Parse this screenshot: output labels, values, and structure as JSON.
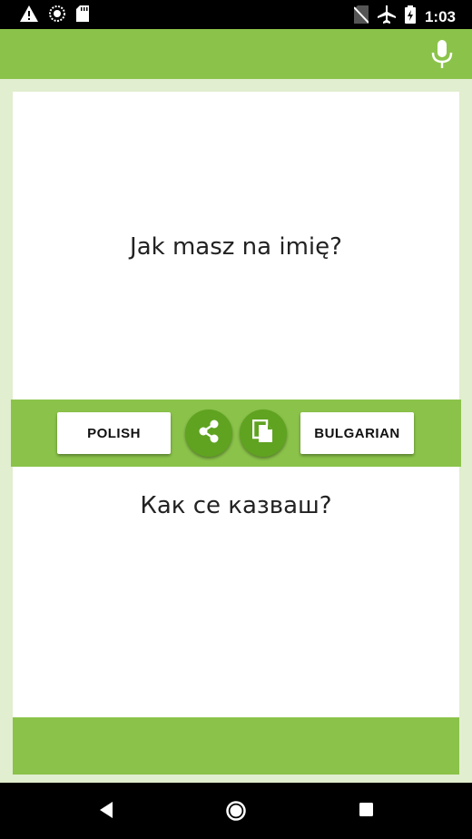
{
  "status_bar": {
    "left_icons": [
      "warning-icon",
      "sync-circle-icon",
      "sd-card-icon"
    ],
    "right_icons": [
      "no-sim-icon",
      "airplane-mode-icon",
      "battery-charging-icon"
    ],
    "time": "1:03"
  },
  "app_bar": {
    "color": "#8bc34a",
    "mic_icon": "microphone-icon"
  },
  "source": {
    "text": "Jak masz na imię?",
    "language": "POLISH"
  },
  "target": {
    "text": "Как се казваш?",
    "language": "BULGARIAN"
  },
  "toolbar": {
    "share_icon": "share-icon",
    "copy_icon": "copy-icon",
    "accent": "#5fa320"
  },
  "nav_bar": {
    "back_icon": "back-icon",
    "home_icon": "home-icon",
    "recents_icon": "recents-icon"
  }
}
